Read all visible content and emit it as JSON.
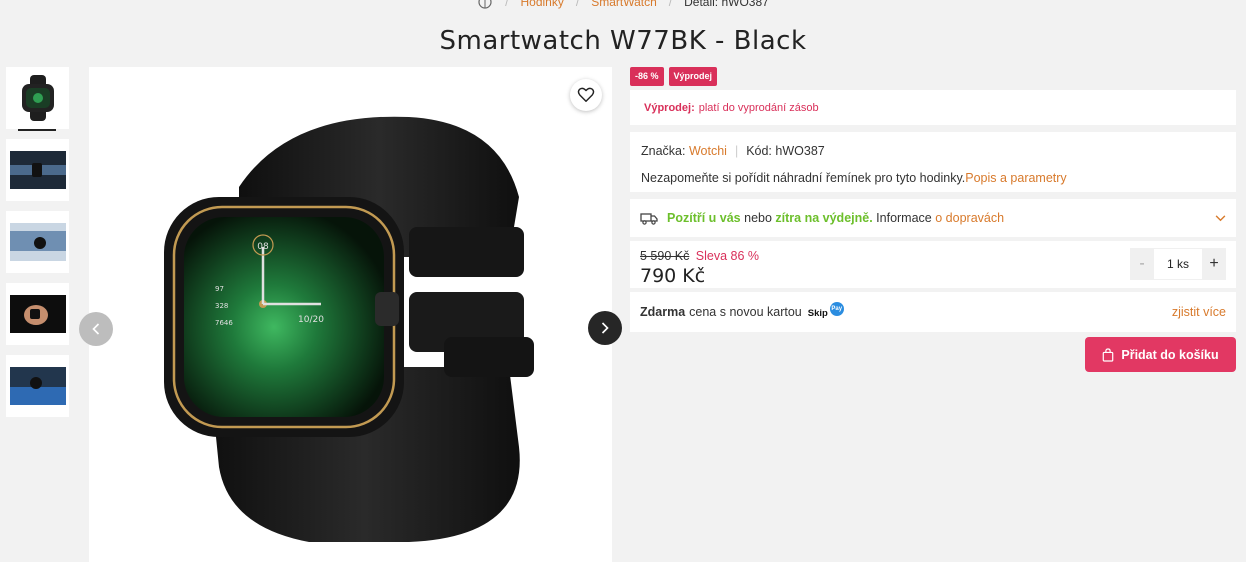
{
  "breadcrumb": {
    "items": [
      "Hodinky",
      "SmartWatch"
    ],
    "current": "Detail: hWO387"
  },
  "title": "Smartwatch W77BK - Black",
  "badges": [
    "-86 %",
    "Výprodej"
  ],
  "sale_notice": {
    "label": "Výprodej:",
    "text": "platí do vyprodání zásob"
  },
  "info": {
    "brand_label": "Značka:",
    "brand": "Wotchi",
    "code_label": "Kód:",
    "code": "hWO387",
    "note": "Nezapomeňte si pořídit náhradní řemínek pro tyto hodinky.",
    "note_link": "Popis a parametry"
  },
  "delivery": {
    "highlight1": "Pozítří u vás",
    "connector": "nebo",
    "highlight2": "zítra na výdejně.",
    "info": "Informace",
    "link": "o dopravách"
  },
  "price": {
    "old": "5 590 Kč",
    "discount": "Sleva 86 %",
    "current": "790 Kč"
  },
  "quantity": {
    "value": "1 ks",
    "minus": "-",
    "plus": "+"
  },
  "free_shipping": {
    "bold": "Zdarma",
    "text": "cena s novou kartou",
    "logo_text": "Skip",
    "logo_badge": "Pay",
    "link": "zjistit více"
  },
  "cart_button": "Přidat do košíku",
  "watch_face": {
    "time": "10/20",
    "number": "08",
    "stats": [
      "97",
      "328",
      "7646"
    ]
  },
  "colors": {
    "accent": "#d9305a",
    "link": "#d87a2c",
    "green": "#6cbf2b"
  }
}
